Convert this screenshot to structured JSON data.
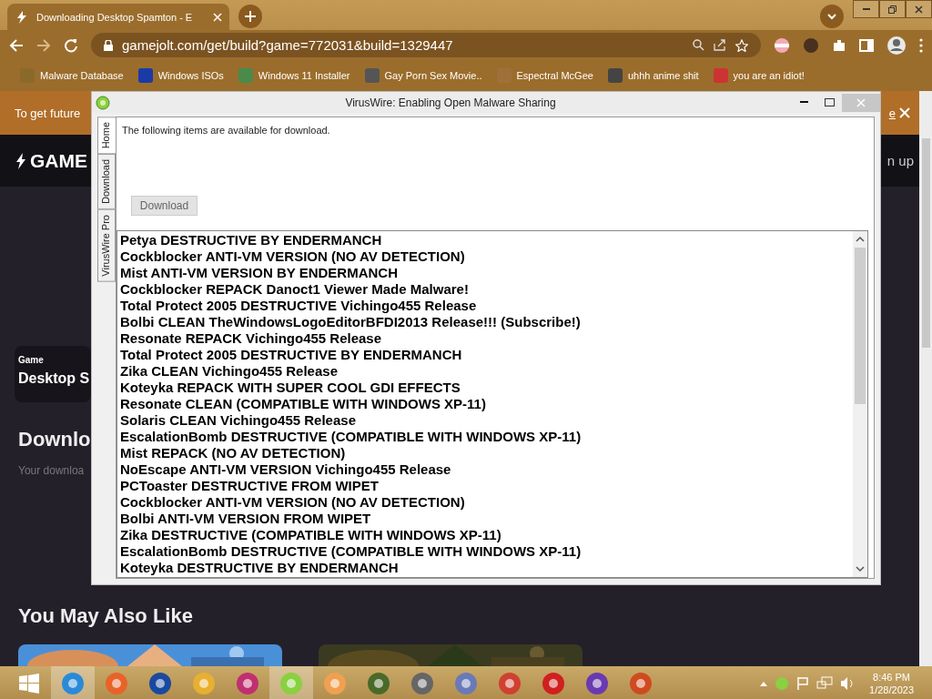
{
  "browser": {
    "tab_title": "Downloading Desktop Spamton - E",
    "url": "gamejolt.com/get/build?game=772031&build=1329447",
    "bookmarks": [
      "Malware Database",
      "Windows ISOs",
      "Windows 11 Installer",
      "Gay Porn Sex Movie..",
      "Espectral McGee",
      "uhhh anime shit",
      "you are an idiot!"
    ]
  },
  "page": {
    "banner": {
      "text": "To get future",
      "link": "e"
    },
    "logo": "GAME",
    "header_link": "n up",
    "game_card": {
      "label": "Game",
      "title": "Desktop S"
    },
    "heading": "Downlo",
    "subtext": "Your downloa",
    "section_title": "You May Also Like"
  },
  "window": {
    "title": "VirusWire: Enabling Open Malware Sharing",
    "tabs": [
      {
        "label": "Home",
        "selected": true
      },
      {
        "label": "Download",
        "selected": false
      },
      {
        "label": "VirusWire Pro",
        "selected": false
      }
    ],
    "intro": "The following items are available for download.",
    "button": "Download",
    "items": [
      "Petya DESTRUCTIVE BY ENDERMANCH",
      "Cockblocker ANTI-VM VERSION (NO AV DETECTION)",
      "Mist ANTI-VM VERSION BY ENDERMANCH",
      "Cockblocker REPACK Danoct1 Viewer Made Malware!",
      "Total Protect 2005 DESTRUCTIVE Vichingo455 Release",
      "Bolbi CLEAN TheWindowsLogoEditorBFDI2013 Release!!! (Subscribe!)",
      "Resonate REPACK Vichingo455 Release",
      "Total Protect 2005 DESTRUCTIVE BY ENDERMANCH",
      "Zika CLEAN Vichingo455 Release",
      "Koteyka REPACK WITH SUPER COOL GDI EFFECTS",
      "Resonate CLEAN (COMPATIBLE WITH WINDOWS XP-11)",
      "Solaris CLEAN Vichingo455 Release",
      "EscalationBomb DESTRUCTIVE (COMPATIBLE WITH WINDOWS XP-11)",
      "Mist REPACK (NO AV DETECTION)",
      "NoEscape ANTI-VM VERSION Vichingo455 Release",
      "PCToaster DESTRUCTIVE FROM WIPET",
      "Cockblocker ANTI-VM VERSION (NO AV DETECTION)",
      "Bolbi ANTI-VM VERSION FROM WIPET",
      "Zika DESTRUCTIVE (COMPATIBLE WITH WINDOWS XP-11)",
      "EscalationBomb DESTRUCTIVE (COMPATIBLE WITH WINDOWS XP-11)",
      "Koteyka DESTRUCTIVE BY ENDERMANCH"
    ]
  },
  "taskbar": {
    "time": "8:46 PM",
    "date": "1/28/2023"
  }
}
